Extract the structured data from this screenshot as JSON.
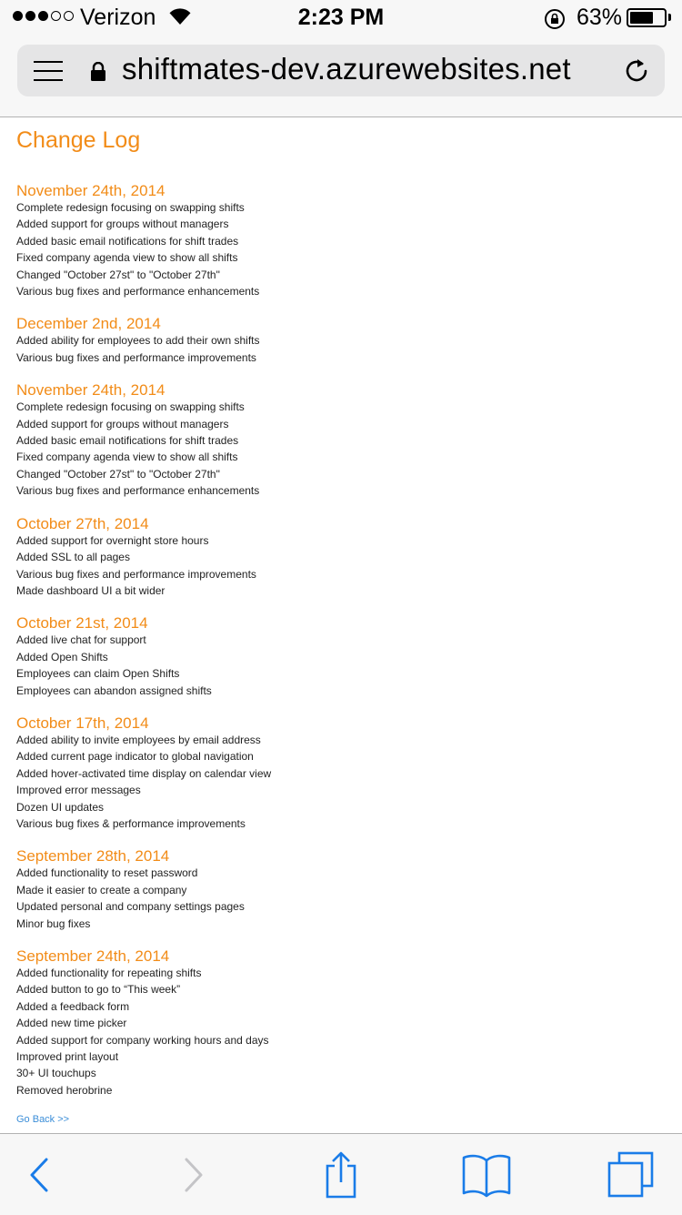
{
  "status_bar": {
    "carrier": "Verizon",
    "time": "2:23 PM",
    "battery_percent": "63%",
    "battery_level": 0.63,
    "signal_bars": 3,
    "signal_max": 5
  },
  "browser": {
    "url": "shiftmates-dev.azurewebsites.net",
    "accent_color": "#1a7ce8"
  },
  "page": {
    "title": "Change Log",
    "accent_color": "#f28c18",
    "entries": [
      {
        "date": "November 24th, 2014",
        "items": [
          "Complete redesign focusing on swapping shifts",
          "Added support for groups without managers",
          "Added basic email notifications for shift trades",
          "Fixed company agenda view to show all shifts",
          "Changed \"October 27st\" to \"October 27th\"",
          "Various bug fixes and performance enhancements"
        ]
      },
      {
        "date": "December 2nd, 2014",
        "items": [
          "Added ability for employees to add their own shifts",
          "Various bug fixes and performance improvements"
        ]
      },
      {
        "date": "November 24th, 2014",
        "items": [
          "Complete redesign focusing on swapping shifts",
          "Added support for groups without managers",
          "Added basic email notifications for shift trades",
          "Fixed company agenda view to show all shifts",
          "Changed \"October 27st\" to \"October 27th\"",
          "Various bug fixes and performance enhancements"
        ]
      },
      {
        "date": "October 27th, 2014",
        "items": [
          "Added support for overnight store hours",
          "Added SSL to all pages",
          "Various bug fixes and performance improvements",
          "Made dashboard UI a bit wider"
        ]
      },
      {
        "date": "October 21st, 2014",
        "items": [
          "Added live chat for support",
          "Added Open Shifts",
          "Employees can claim Open Shifts",
          "Employees can abandon assigned shifts"
        ]
      },
      {
        "date": "October 17th, 2014",
        "items": [
          "Added ability to invite employees by email address",
          "Added current page indicator to global navigation",
          "Added hover-activated time display on calendar view",
          "Improved error messages",
          "Dozen UI updates",
          "Various bug fixes & performance improvements"
        ]
      },
      {
        "date": "September 28th, 2014",
        "items": [
          "Added functionality to reset password",
          "Made it easier to create a company",
          "Updated personal and company settings pages",
          "Minor bug fixes"
        ]
      },
      {
        "date": "September 24th, 2014",
        "items": [
          "Added functionality for repeating shifts",
          "Added button to go to “This week”",
          "Added a feedback form",
          "Added new time picker",
          "Added support for company working hours and days",
          "Improved print layout",
          "30+ UI touchups",
          "Removed herobrine"
        ]
      }
    ],
    "go_back_label": "Go Back >>"
  },
  "toolbar": {
    "icons": [
      "back-icon",
      "forward-icon",
      "share-icon",
      "bookmarks-icon",
      "tabs-icon"
    ]
  }
}
